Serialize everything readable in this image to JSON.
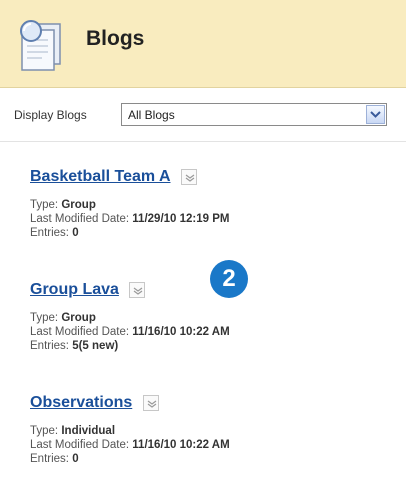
{
  "header": {
    "title": "Blogs",
    "icon": "blog-page-icon"
  },
  "filter": {
    "label": "Display Blogs",
    "selected": "All Blogs"
  },
  "step_badge": "2",
  "blogs": [
    {
      "title": "Basketball Team A",
      "type_label": "Type:",
      "type": "Group",
      "modified_label": "Last Modified Date:",
      "modified": "11/29/10 12:19 PM",
      "entries_label": "Entries:",
      "entries": "0"
    },
    {
      "title": "Group Lava",
      "type_label": "Type:",
      "type": "Group",
      "modified_label": "Last Modified Date:",
      "modified": "11/16/10 10:22 AM",
      "entries_label": "Entries:",
      "entries": "5(5 new)"
    },
    {
      "title": "Observations",
      "type_label": "Type:",
      "type": "Individual",
      "modified_label": "Last Modified Date:",
      "modified": "11/16/10 10:22 AM",
      "entries_label": "Entries:",
      "entries": "0"
    }
  ]
}
